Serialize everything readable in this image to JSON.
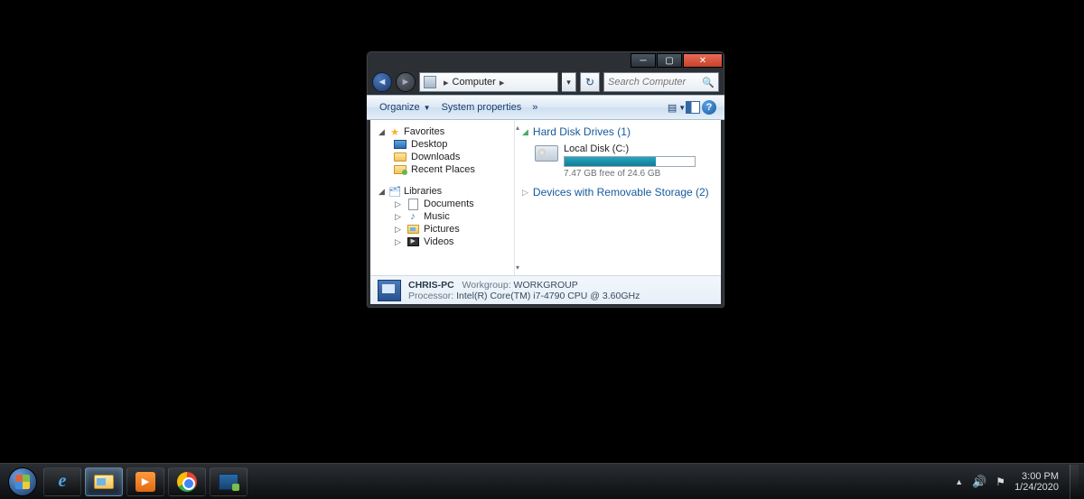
{
  "addressbar": {
    "path_label": "Computer",
    "search_placeholder": "Search Computer"
  },
  "toolbar": {
    "organize": "Organize",
    "system_properties": "System properties",
    "more": "»"
  },
  "nav": {
    "favorites": {
      "label": "Favorites",
      "items": [
        {
          "label": "Desktop"
        },
        {
          "label": "Downloads"
        },
        {
          "label": "Recent Places"
        }
      ]
    },
    "libraries": {
      "label": "Libraries",
      "items": [
        {
          "label": "Documents"
        },
        {
          "label": "Music"
        },
        {
          "label": "Pictures"
        },
        {
          "label": "Videos"
        }
      ]
    }
  },
  "content": {
    "hdd_header": "Hard Disk Drives (1)",
    "drive": {
      "name": "Local Disk (C:)",
      "free_text": "7.47 GB free of 24.6 GB",
      "fill_percent": 70
    },
    "removable_header": "Devices with Removable Storage (2)"
  },
  "details": {
    "computer_name": "CHRIS-PC",
    "workgroup_label": "Workgroup:",
    "workgroup_value": "WORKGROUP",
    "processor_label": "Processor:",
    "processor_value": "Intel(R) Core(TM) i7-4790 CPU @ 3.60GHz"
  },
  "taskbar": {
    "time": "3:00 PM",
    "date": "1/24/2020"
  }
}
